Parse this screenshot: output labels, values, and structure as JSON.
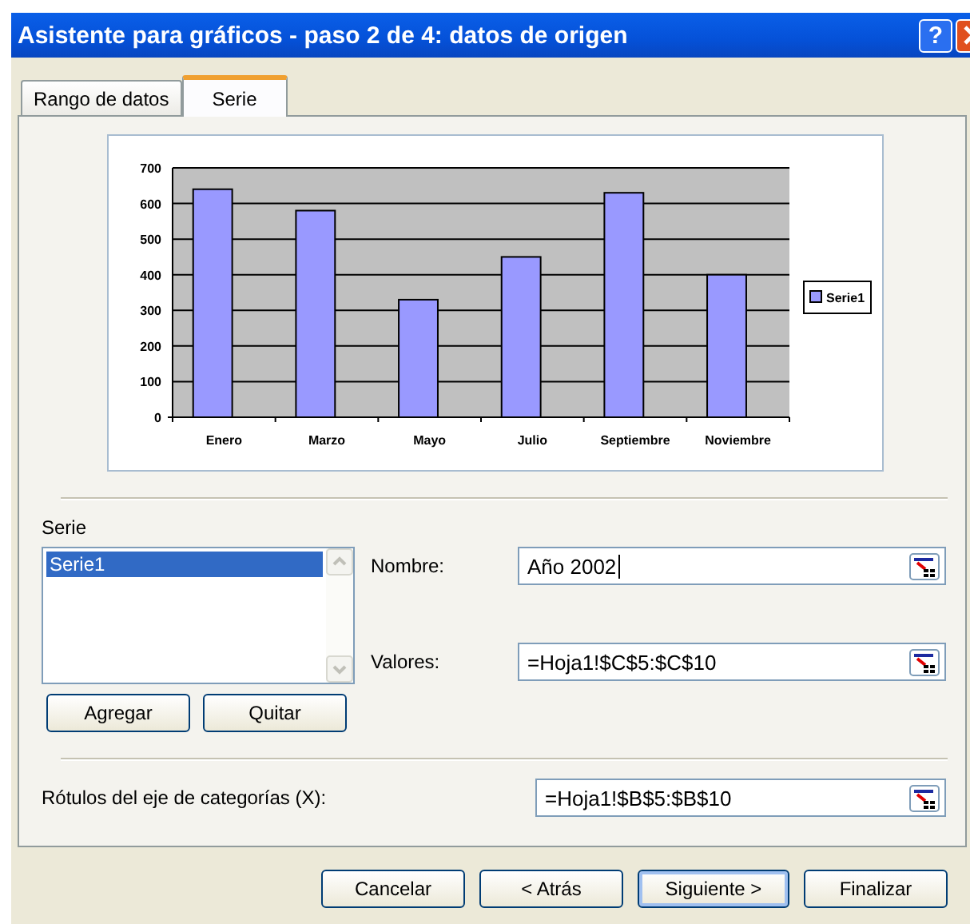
{
  "window": {
    "title": "Asistente para gráficos - paso 2 de 4: datos de origen",
    "help": "?"
  },
  "tabs": [
    {
      "label": "Rango de datos",
      "selected": false
    },
    {
      "label": "Serie",
      "selected": true
    }
  ],
  "chart": {
    "chart_data": {
      "type": "bar",
      "grid": true,
      "categories": [
        "Enero",
        "Marzo",
        "Mayo",
        "Julio",
        "Septiembre",
        "Noviembre"
      ],
      "ylim": [
        0,
        700
      ],
      "yticks": [
        0,
        100,
        200,
        300,
        400,
        500,
        600,
        700
      ],
      "series": [
        {
          "name": "Serie1",
          "color": "#9999ff",
          "values": [
            640,
            580,
            330,
            450,
            630,
            400
          ]
        }
      ]
    }
  },
  "series_panel": {
    "label": "Serie",
    "items": [
      {
        "label": "Serie1",
        "selected": true
      }
    ],
    "buttons": [
      "Agregar",
      "Quitar"
    ]
  },
  "fields": [
    {
      "label": "Nombre:",
      "value": "Año 2002"
    },
    {
      "label": "Valores:",
      "value": "=Hoja1!$C$5:$C$10"
    }
  ],
  "category_field": {
    "label": "Rótulos del eje de categorías (X):",
    "value": "=Hoja1!$B$5:$B$10"
  },
  "buttons": [
    {
      "label": "Cancelar",
      "default": false
    },
    {
      "label": "< Atrás",
      "default": false
    },
    {
      "label": "Siguiente >",
      "default": true
    },
    {
      "label": "Finalizar",
      "default": false
    }
  ]
}
